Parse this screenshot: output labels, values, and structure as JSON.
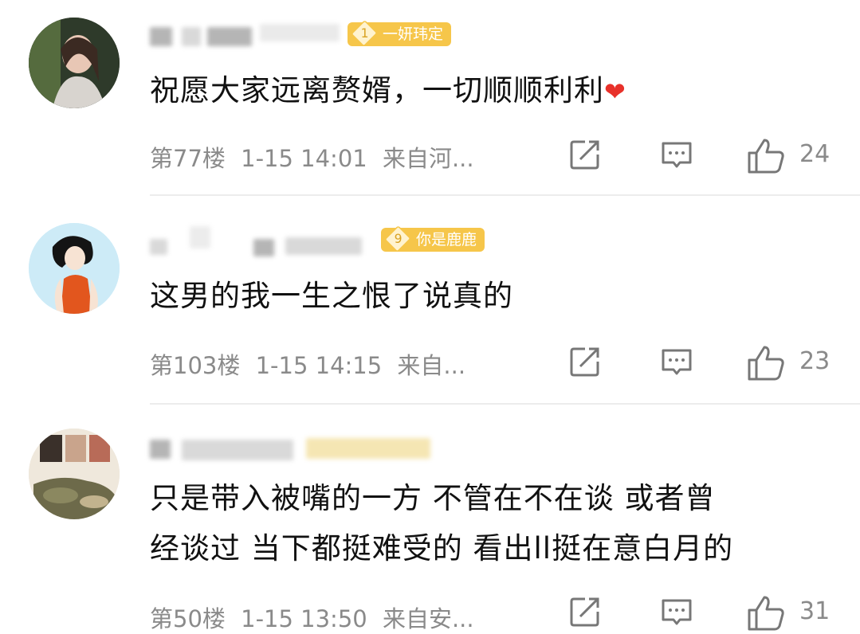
{
  "comments": [
    {
      "badge_level": "1",
      "badge_text": "一妍玮定",
      "text": "祝愿大家远离赘婿，一切顺顺利利",
      "heart": "❤",
      "floor": "第77楼",
      "time": "1-15 14:01",
      "location": "来自河...",
      "likes": "24"
    },
    {
      "badge_level": "9",
      "badge_text": "你是鹿鹿",
      "text": "这男的我一生之恨了说真的",
      "floor": "第103楼",
      "time": "1-15 14:15",
      "location": "来自...",
      "likes": "23"
    },
    {
      "text_line1": "只是带入被嘴的一方 不管在不在谈 或者曾",
      "text_line2": "经谈过 当下都挺难受的 看出ll挺在意白月的",
      "floor": "第50楼",
      "time": "1-15 13:50",
      "location": "来自安...",
      "likes": "31"
    }
  ],
  "icons": [
    "share-icon",
    "comment-icon",
    "like-icon",
    "heart-icon"
  ],
  "colors": {
    "badge": "#f6c64a",
    "meta": "#8a8a8a",
    "heart": "#e8312a"
  }
}
